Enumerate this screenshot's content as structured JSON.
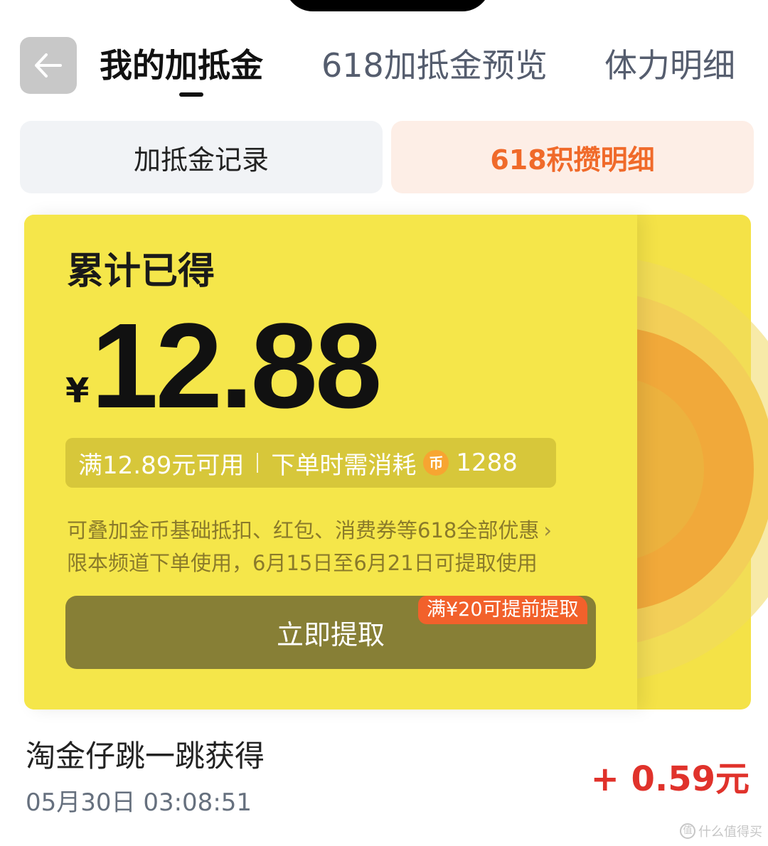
{
  "header": {
    "tabs": [
      {
        "label": "我的加抵金",
        "active": true
      },
      {
        "label": "618加抵金预览",
        "active": false
      },
      {
        "label": "体力明细",
        "active": false
      }
    ]
  },
  "segments": [
    {
      "label": "加抵金记录",
      "active": false
    },
    {
      "label": "618积攒明细",
      "active": true
    }
  ],
  "card": {
    "title": "累计已得",
    "currency": "¥",
    "amount": "12.88",
    "condition": "满12.89元可用",
    "consume_label": "下单时需消耗",
    "coin_glyph": "币",
    "consume_amount": "1288",
    "note1": "可叠加金币基础抵扣、红包、消费券等618全部优惠",
    "note1_chevron": "›",
    "note2": "限本频道下单使用，6月15日至6月21日可提取使用",
    "claim_button": "立即提取",
    "claim_badge": "满¥20可提前提取"
  },
  "record": {
    "title": "淘金仔跳一跳获得",
    "time": "05月30日 03:08:51",
    "amount": "+ 0.59元"
  },
  "watermark": {
    "icon_glyph": "值",
    "text": "什么值得买"
  },
  "colors": {
    "card_yellow": "#f5e64a",
    "accent_orange": "#f06a2a",
    "amount_red": "#e0322b",
    "button_olive": "#877f36"
  }
}
